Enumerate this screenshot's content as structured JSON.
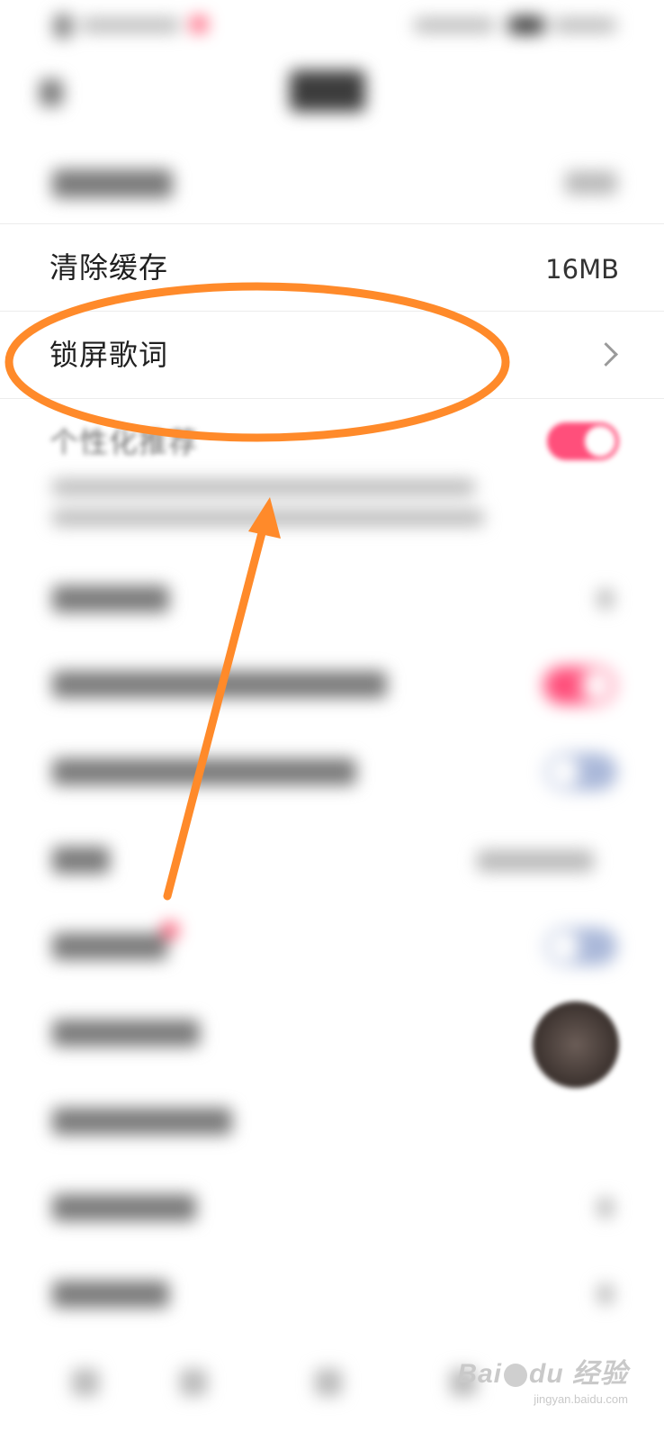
{
  "settings": {
    "clear_cache": {
      "label": "清除缓存",
      "value": "16MB"
    },
    "lock_screen_lyrics": {
      "label": "锁屏歌词"
    },
    "personalized_recommend": {
      "label": "个性化推荐",
      "enabled": true
    }
  },
  "watermark": {
    "brand_left": "Bai",
    "brand_right": "du",
    "brand_cn": "经验",
    "url": "jingyan.baidu.com"
  },
  "colors": {
    "toggle_on": "#ff4f7b",
    "annotation": "#ff8a2a"
  }
}
